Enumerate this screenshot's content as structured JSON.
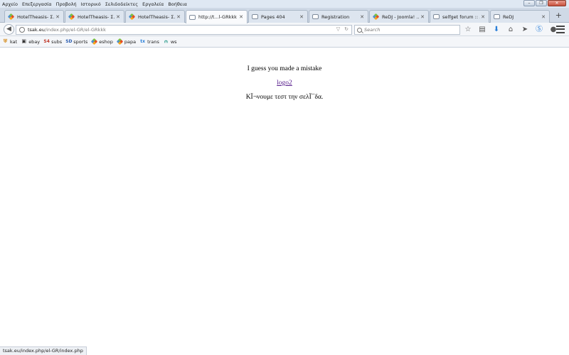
{
  "menu": [
    "Αρχείο",
    "Επεξεργασία",
    "Προβολή",
    "Ιστορικό",
    "Σελιδοδείκτες",
    "Εργαλεία",
    "Βοήθεια"
  ],
  "tabs": [
    {
      "label": "HotelTheasis- Σ...",
      "icon": "joomla-icon",
      "active": false
    },
    {
      "label": "HotelTheasis- Σ...",
      "icon": "joomla-icon",
      "active": false
    },
    {
      "label": "HotelTheasis- Σ...",
      "icon": "joomla-icon",
      "active": false
    },
    {
      "label": "http://t...l-GRkkk",
      "icon": "page-icon",
      "active": true
    },
    {
      "label": "Pages 404",
      "icon": "page-icon",
      "active": false
    },
    {
      "label": "Registration",
      "icon": "page-icon",
      "active": false
    },
    {
      "label": "ReDJ - Joomla! ...",
      "icon": "joomla-icon",
      "active": false
    },
    {
      "label": "selfget forum :: ...",
      "icon": "page-icon",
      "active": false
    },
    {
      "label": "ReDJ",
      "icon": "page-icon",
      "active": false
    }
  ],
  "new_tab": "+",
  "url": {
    "host": "tsak.eu",
    "path": "/index.php/el-GR/el-GRkkk"
  },
  "search": {
    "placeholder": "Search"
  },
  "bookmarks": [
    {
      "label": "kat",
      "icon": "shield-icon",
      "color": "#d48a1a"
    },
    {
      "label": "ebay",
      "icon": "ebay-icon",
      "color": "#333333"
    },
    {
      "label": "subs",
      "icon": "s4-icon",
      "color": "#c0392b"
    },
    {
      "label": "sports",
      "icon": "sd-icon",
      "color": "#2a5db0"
    },
    {
      "label": "eshop",
      "icon": "joomla-icon",
      "color": "#e44d26"
    },
    {
      "label": "papa",
      "icon": "joomla-icon",
      "color": "#e44d26"
    },
    {
      "label": "trans",
      "icon": "tx-icon",
      "color": "#2a7fd8"
    },
    {
      "label": "ws",
      "icon": "ws-icon",
      "color": "#2f9e8f"
    }
  ],
  "page": {
    "message": "I guess you made a mistake",
    "link": "logo2",
    "greek": "ΚΪ¬νουμε τεστ την σελΪ¯δα."
  },
  "status": "tsak.eu/index.php/el-GR/index.php",
  "colors": {
    "accent": "#2a7fd8",
    "link_visited": "#551a8b"
  }
}
